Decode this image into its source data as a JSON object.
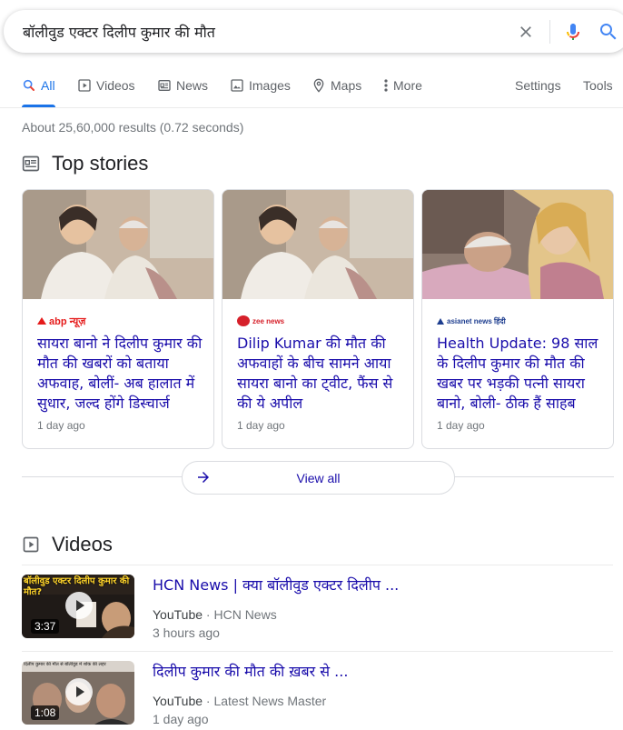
{
  "search": {
    "query": "बॉलीवुड एक्टर दिलीप कुमार की मौत"
  },
  "tabs": {
    "all": "All",
    "videos": "Videos",
    "news": "News",
    "images": "Images",
    "maps": "Maps",
    "more": "More",
    "settings": "Settings",
    "tools": "Tools"
  },
  "result_stats": "About 25,60,000 results (0.72 seconds)",
  "top_stories": {
    "title": "Top stories",
    "cards": [
      {
        "source": "abp न्यूज़",
        "headline": "सायरा बानो ने दिलीप कुमार की मौत की खबरों को बताया अफवाह, बोलीं- अब हालात में सुधार, जल्द होंगे डिस्चार्ज",
        "time": "1 day ago"
      },
      {
        "source": "zee news",
        "headline": "Dilip Kumar की मौत की अफवाहों के बीच सामने आया सायरा बानो का ट्वीट, फैंस से की ये अपील",
        "time": "1 day ago"
      },
      {
        "source": "asianet news हिंदी",
        "headline": "Health Update: 98 साल के दिलीप कुमार की मौत की खबर पर भड़की पत्नी सायरा बानो, बोली- ठीक हैं साहब",
        "time": "1 day ago"
      }
    ],
    "view_all": "View all"
  },
  "videos": {
    "title": "Videos",
    "items": [
      {
        "title": "HCN News | क्या बॉलीवुड एक्टर दिलीप ...",
        "platform": "YouTube",
        "channel": "HCN News",
        "time": "3 hours ago",
        "duration": "3:37",
        "thumb_text": "बॉलीवुड एक्टर दिलीप कुमार की मौत?"
      },
      {
        "title": "दिलीप कुमार की मौत की ख़बर से ...",
        "platform": "YouTube",
        "channel": "Latest News Master",
        "time": "1 day ago",
        "duration": "1:08",
        "thumb_text": "दिलीप कुमार की मौत से बॉलीवुड में शोक की लहर"
      }
    ]
  },
  "colors": {
    "link": "#1a0dab",
    "accent": "#1a73e8",
    "abp_red": "#e51b1b",
    "gray": "#70757a"
  }
}
